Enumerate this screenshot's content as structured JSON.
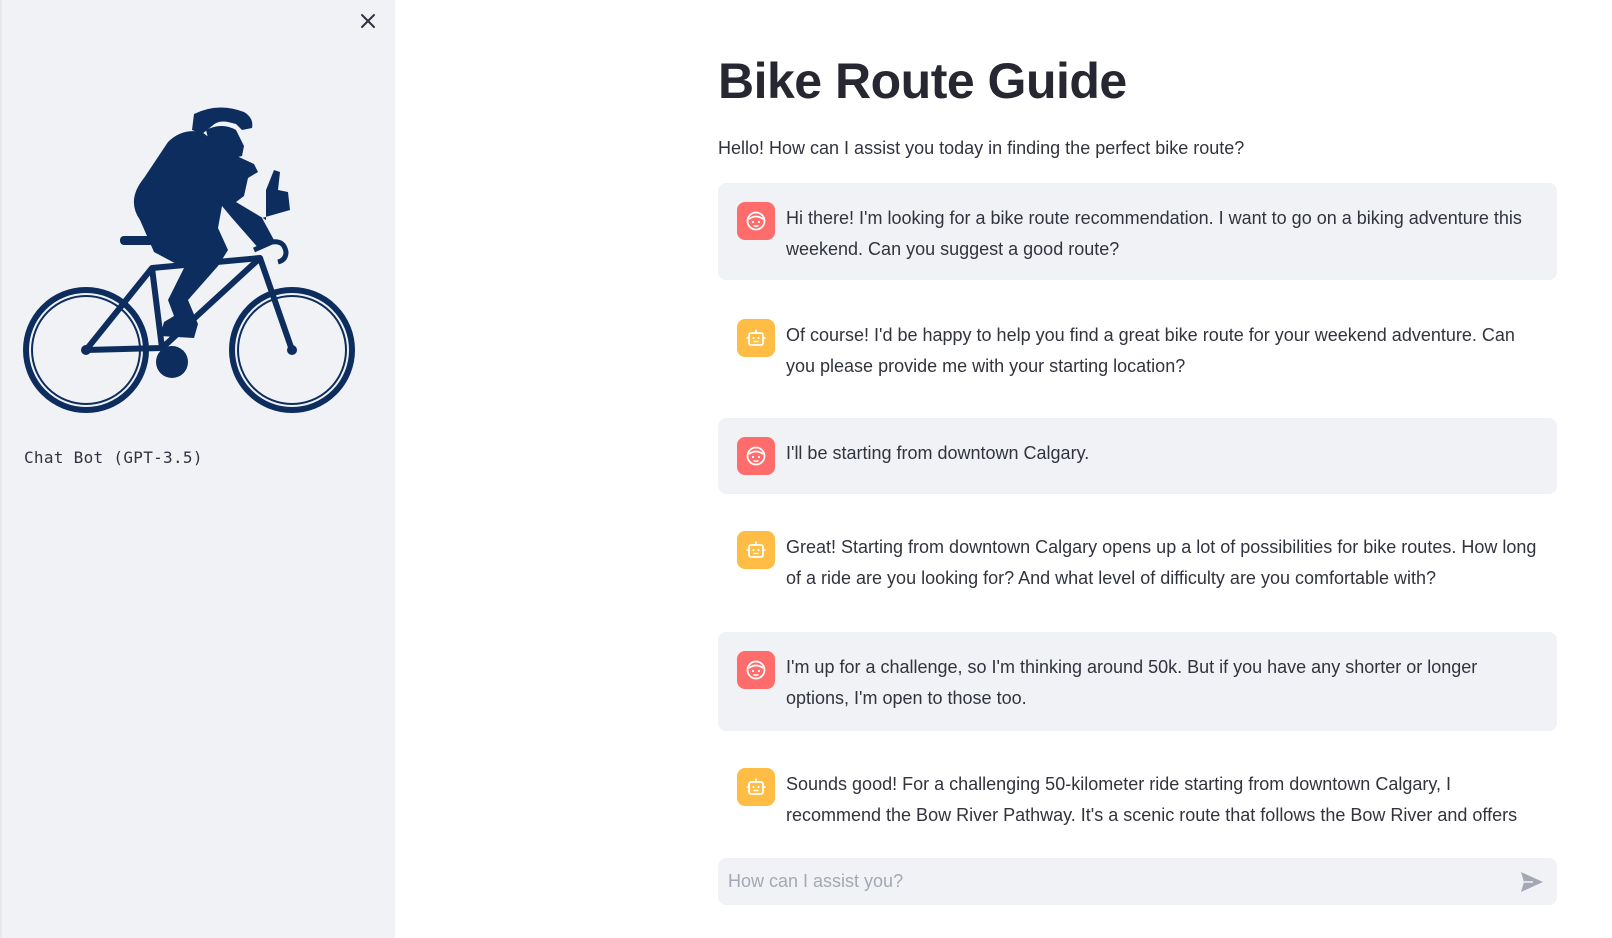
{
  "sidebar": {
    "caption": "Chat Bot (GPT-3.5)"
  },
  "main": {
    "title": "Bike Route Guide",
    "intro": "Hello! How can I assist you today in finding the perfect bike route?"
  },
  "messages": [
    {
      "role": "user",
      "avatar_icon": "face-icon",
      "text": "Hi there! I'm looking for a bike route recommendation. I want to go on a biking adventure this weekend. Can you suggest a good route?"
    },
    {
      "role": "assistant",
      "avatar_icon": "robot-icon",
      "text": "Of course! I'd be happy to help you find a great bike route for your weekend adventure. Can you please provide me with your starting location?"
    },
    {
      "role": "user",
      "avatar_icon": "face-icon",
      "text": "I'll be starting from downtown Calgary."
    },
    {
      "role": "assistant",
      "avatar_icon": "robot-icon",
      "text": "Great! Starting from downtown Calgary opens up a lot of possibilities for bike routes. How long of a ride are you looking for? And what level of difficulty are you comfortable with?"
    },
    {
      "role": "user",
      "avatar_icon": "face-icon",
      "text": "I'm up for a challenge, so I'm thinking around 50k. But if you have any shorter or longer options, I'm open to those too."
    },
    {
      "role": "assistant",
      "avatar_icon": "robot-icon",
      "text": "Sounds good! For a challenging 50-kilometer ride starting from downtown Calgary, I recommend the Bow River Pathway. It's a scenic route that follows the Bow River and offers beautiful views of"
    }
  ],
  "chat_input": {
    "placeholder": "How can I assist you?"
  },
  "colors": {
    "user_avatar": "#ff6c6c",
    "assistant_avatar": "#ffbd45",
    "logo": "#0d2d5e",
    "sidebar_bg": "#f0f2f6"
  }
}
